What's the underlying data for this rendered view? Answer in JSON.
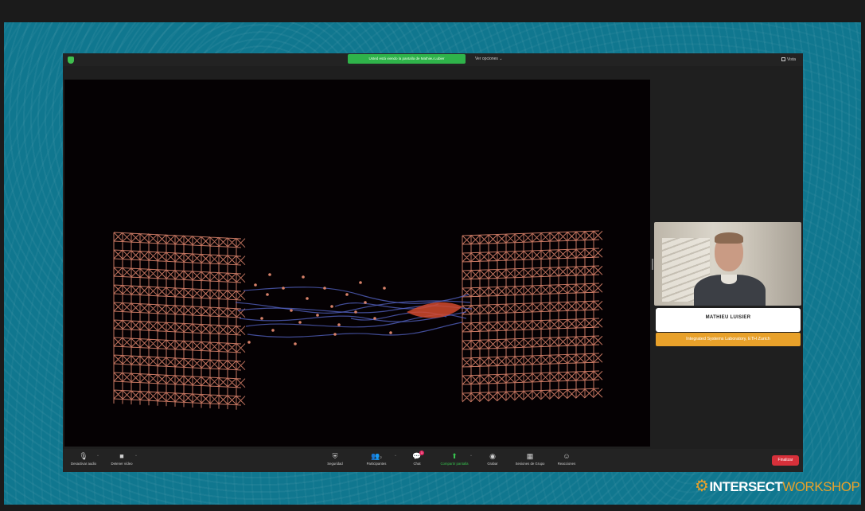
{
  "meeting": {
    "share_banner": "Usted está viendo la pantalla de Mathieu Lubier",
    "view_options": "Ver opciones ⌄",
    "view_button": "Vista"
  },
  "participant": {
    "name": "MATHIEU LUISIER",
    "affiliation": "Integrated Systems Laboratory, ETH Zurich"
  },
  "toolbar": {
    "items": [
      {
        "label": "Desactivar audio",
        "icon": "microphone-icon"
      },
      {
        "label": "Detener vídeo",
        "icon": "video-camera-icon"
      },
      {
        "label": "Seguridad",
        "icon": "shield-icon"
      },
      {
        "label": "Participantes",
        "icon": "participants-icon",
        "count": "2"
      },
      {
        "label": "Chat",
        "icon": "chat-icon",
        "badge": "1"
      },
      {
        "label": "Compartir pantalla",
        "icon": "share-screen-icon"
      },
      {
        "label": "Grabar",
        "icon": "record-icon"
      },
      {
        "label": "Sesiones de Grupo",
        "icon": "breakout-rooms-icon"
      },
      {
        "label": "Reacciones",
        "icon": "reactions-icon"
      }
    ],
    "leave_label": "Finalizar"
  },
  "branding": {
    "logo_part1": "INTERSECT",
    "logo_part2": "WORKSHOP"
  },
  "colors": {
    "teal_background": "#10778f",
    "zoom_green": "#2fb34a",
    "lattice_orange": "#d9826a",
    "electron_blue": "#5566c8",
    "affiliation_orange": "#e8a12a",
    "leave_red": "#d6303a"
  }
}
